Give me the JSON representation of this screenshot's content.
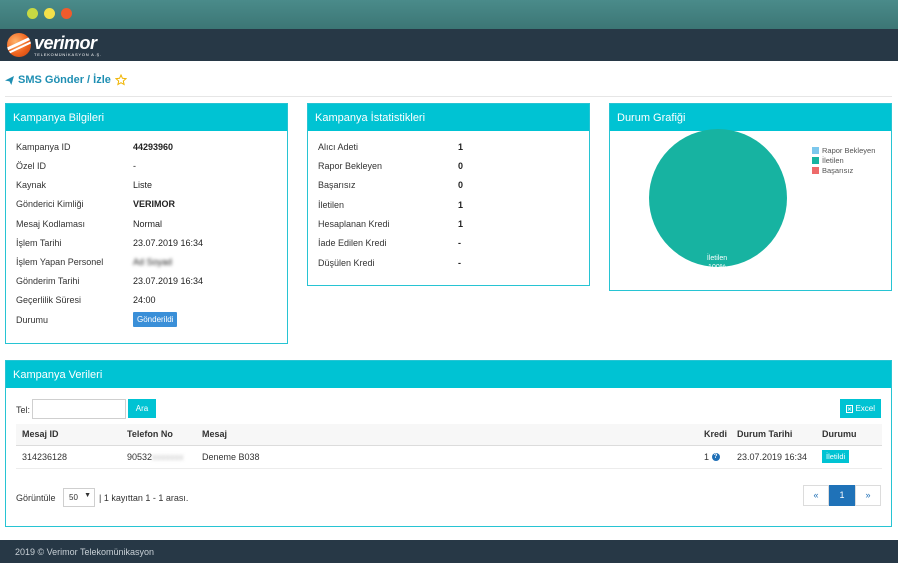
{
  "brand": {
    "name": "verimor",
    "tagline": "TELEKOMÜNİKASYON A.Ş."
  },
  "page": {
    "title": "SMS Gönder / İzle"
  },
  "campaign_info": {
    "title": "Kampanya Bilgileri",
    "rows": [
      {
        "key": "Kampanya ID",
        "value": "44293960"
      },
      {
        "key": "Özel ID",
        "value": "-"
      },
      {
        "key": "Kaynak",
        "value": "Liste"
      },
      {
        "key": "Gönderici Kimliği",
        "value": "VERIMOR"
      },
      {
        "key": "Mesaj Kodlaması",
        "value": "Normal"
      },
      {
        "key": "İşlem Tarihi",
        "value": "23.07.2019 16:34"
      },
      {
        "key": "İşlem Yapan Personel",
        "value": "Ad Soyad"
      },
      {
        "key": "Gönderim Tarihi",
        "value": "23.07.2019 16:34"
      },
      {
        "key": "Geçerlilik Süresi",
        "value": "24:00"
      },
      {
        "key": "Durumu",
        "value": "Gönderildi"
      }
    ]
  },
  "campaign_stats": {
    "title": "Kampanya İstatistikleri",
    "rows": [
      {
        "key": "Alıcı Adeti",
        "value": "1"
      },
      {
        "key": "Rapor Bekleyen",
        "value": "0"
      },
      {
        "key": "Başarısız",
        "value": "0"
      },
      {
        "key": "İletilen",
        "value": "1"
      },
      {
        "key": "Hesaplanan Kredi",
        "value": "1"
      },
      {
        "key": "İade Edilen Kredi",
        "value": "-"
      },
      {
        "key": "Düşülen Kredi",
        "value": "-"
      }
    ]
  },
  "status_chart": {
    "title": "Durum Grafiği",
    "slice_label": "İletilen",
    "slice_percent": "100%"
  },
  "chart_data": {
    "type": "pie",
    "categories": [
      "Rapor Bekleyen",
      "İletilen",
      "Başarısız"
    ],
    "values": [
      0,
      100,
      0
    ],
    "colors": [
      "#7cc7ec",
      "#17b3a1",
      "#ee6a6a"
    ],
    "legend_position": "top-right"
  },
  "campaign_data": {
    "title": "Kampanya Verileri",
    "search_label": "Tel:",
    "search_value": "",
    "search_button": "Ara",
    "excel_button": "Excel",
    "columns": [
      "Mesaj ID",
      "Telefon No",
      "Mesaj",
      "Kredi",
      "Durum Tarihi",
      "Durumu"
    ],
    "rows": [
      {
        "id": "314236128",
        "phone": "90532",
        "phone_masked": "xxxxxxx",
        "message": "Deneme B038",
        "credit": "1",
        "date": "23.07.2019 16:34",
        "status": "İletildi"
      }
    ],
    "show_label": "Görüntüle",
    "page_size": "50",
    "record_info": "| 1 kayıttan 1 - 1 arası.",
    "pager": {
      "prev": "«",
      "current": "1",
      "next": "»"
    }
  },
  "footer": {
    "text": "2019 © Verimor Telekomünikasyon"
  },
  "colors": {
    "accent": "#00c3d3",
    "nav": "#273846",
    "link": "#1f8fb3",
    "pager_active": "#1f72b8"
  }
}
